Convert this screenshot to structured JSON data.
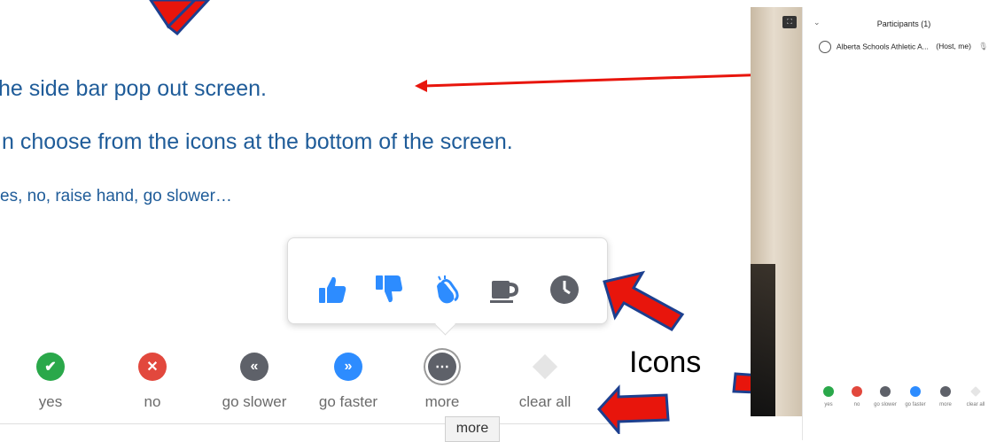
{
  "slide": {
    "line1": "he side bar pop out screen.",
    "line2": "n choose from the icons at the bottom of the screen.",
    "line3": "es, no, raise hand, go slower…",
    "icons_label": "Icons"
  },
  "feedback": {
    "items": [
      {
        "label": "yes",
        "icon": "check-icon",
        "color": "#2aa84a"
      },
      {
        "label": "no",
        "icon": "x-icon",
        "color": "#e2483d"
      },
      {
        "label": "go slower",
        "icon": "rewind-icon",
        "color": "#5e6169"
      },
      {
        "label": "go faster",
        "icon": "fast-forward-icon",
        "color": "#2d8cff"
      },
      {
        "label": "more",
        "icon": "ellipsis-icon",
        "color": "#5e6169"
      },
      {
        "label": "clear all",
        "icon": "eraser-icon",
        "color": "#e5e5e5"
      }
    ],
    "tooltip": "more"
  },
  "emoji_popup": {
    "icons": [
      "thumbs-up-icon",
      "thumbs-down-icon",
      "clap-icon",
      "coffee-icon",
      "clock-icon"
    ],
    "color": "#2d8cff",
    "gray": "#5e6169"
  },
  "participants_panel": {
    "title": "Participants (1)",
    "participant_name": "Alberta Schools Athletic A...",
    "participant_role": "(Host, me)",
    "mini_items": [
      "yes",
      "no",
      "go slower",
      "go faster",
      "more",
      "clear all"
    ]
  },
  "annotation_colors": {
    "arrow_red": "#e8150c",
    "arrow_border": "#1c3f8f"
  }
}
